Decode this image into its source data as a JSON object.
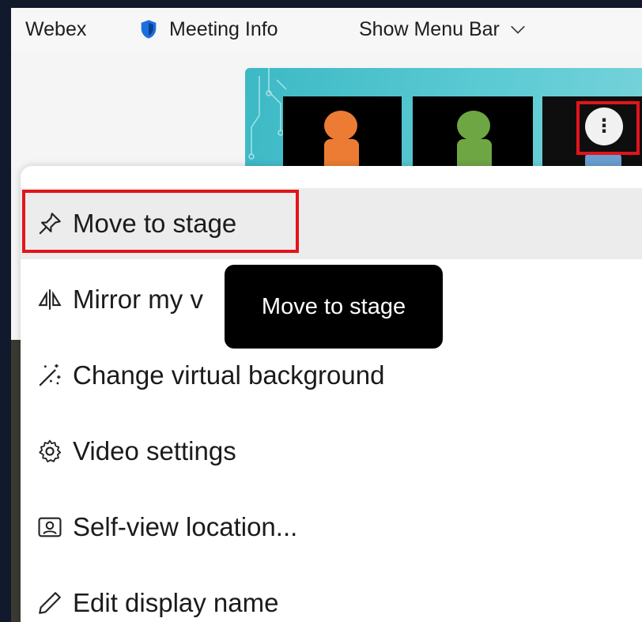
{
  "topbar": {
    "webex_label": "Webex",
    "meeting_info_label": "Meeting Info",
    "show_menu_bar_label": "Show Menu Bar"
  },
  "filmstrip": {
    "more_button_label": "⋮",
    "participants": [
      {
        "avatar_color": "#ec7c34"
      },
      {
        "avatar_color": "#6fa644"
      },
      {
        "avatar_color": "#6a9ed1"
      }
    ]
  },
  "menu": {
    "items": [
      {
        "label": "Move to stage",
        "icon": "pin-icon"
      },
      {
        "label": "Mirror my v",
        "icon": "mirror-icon"
      },
      {
        "label": "Change virtual background",
        "icon": "magic-wand-icon"
      },
      {
        "label": "Video settings",
        "icon": "gear-icon"
      },
      {
        "label": "Self-view location...",
        "icon": "self-view-icon"
      },
      {
        "label": "Edit display name",
        "icon": "pencil-icon"
      }
    ]
  },
  "tooltip": {
    "text": "Move to stage"
  },
  "colors": {
    "highlight": "#e2141b",
    "accent_blue": "#1d6fe0",
    "filmstrip_teal": "#4cc2cc"
  }
}
